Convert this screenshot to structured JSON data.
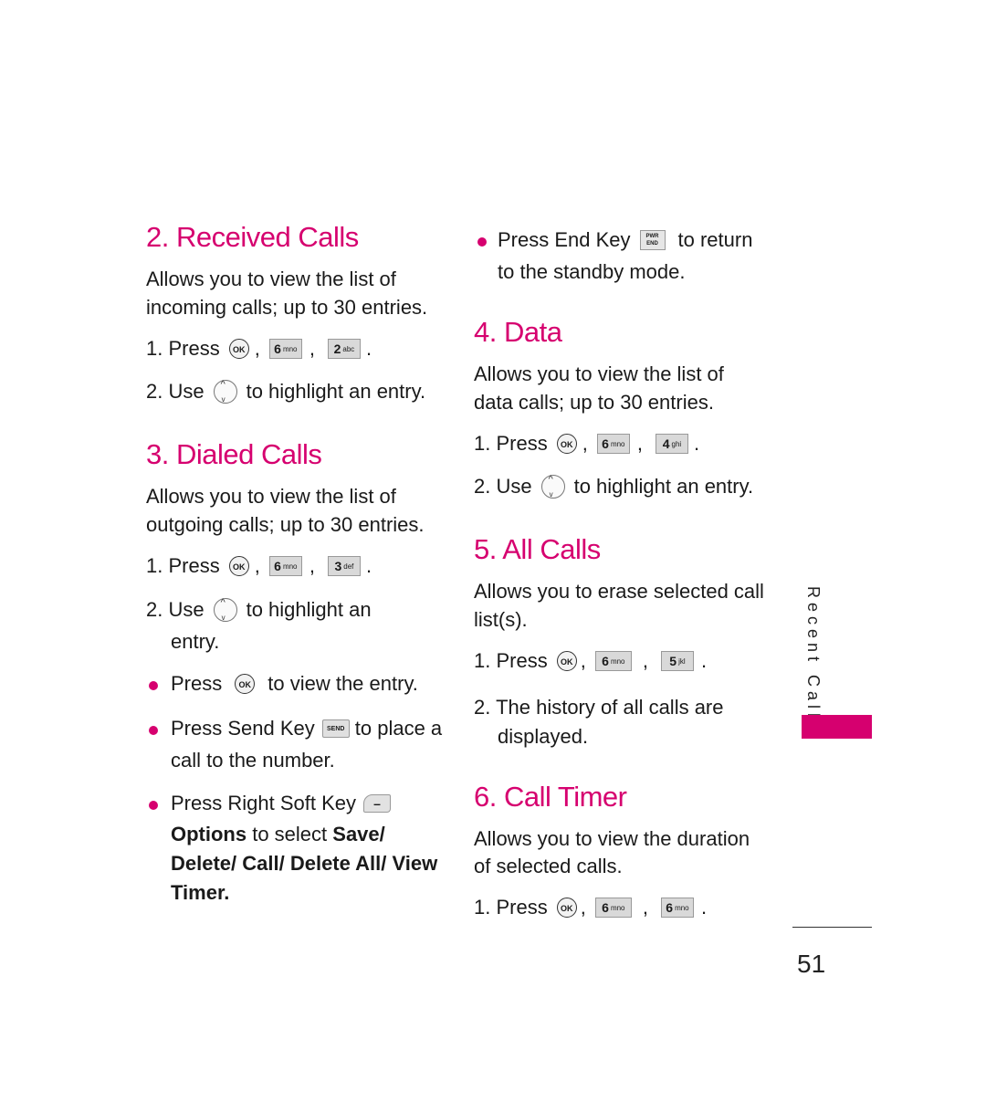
{
  "sections": {
    "received": {
      "title": "2. Received Calls",
      "desc_lines": [
        "Allows you to view the list of",
        "incoming calls; up to 30 entries."
      ],
      "step1_label": "1. Press",
      "step1_keys": [
        "OK",
        "6 mno",
        "2 abc"
      ],
      "step2_label": "2. Use",
      "step2_text": "to highlight an entry."
    },
    "dialed": {
      "title": "3. Dialed Calls",
      "desc_lines": [
        "Allows you to view the list of",
        "outgoing calls; up to 30 entries."
      ],
      "step1_label": "1. Press",
      "step1_keys": [
        "OK",
        "6 mno",
        "3 def"
      ],
      "step2_label": "2.  Use",
      "step2_text": "to highlight an",
      "step2_cont": "entry.",
      "bullets": [
        {
          "before": "Press",
          "key": "OK",
          "after": "to view the entry."
        },
        {
          "before": "Press Send Key",
          "key": "SEND",
          "after": "to place a",
          "cont": "call to the number."
        },
        {
          "before": "Press Right Soft Key",
          "key": "right-soft-key",
          "line2_bold1": "Options",
          "line2_plain": " to select ",
          "line2_bold2": "Save/",
          "line3": "Delete/ Call/ Delete All/ View",
          "line4": "Timer."
        }
      ]
    },
    "end_key_bullet": {
      "before": "Press End Key",
      "key": "PWR END",
      "after": "to return",
      "cont": "to the standby mode."
    },
    "data": {
      "title": "4. Data",
      "desc_lines": [
        "Allows you to view the list of",
        "data calls; up to 30 entries."
      ],
      "step1_label": "1. Press",
      "step1_keys": [
        "OK",
        "6 mno",
        "4 ghi"
      ],
      "step2_label": "2. Use",
      "step2_text": "to highlight an entry."
    },
    "all": {
      "title": "5. All Calls",
      "desc_lines": [
        "Allows you to erase selected call",
        "list(s)."
      ],
      "step1_label": "1. Press",
      "step1_keys": [
        "OK",
        "6 mno",
        "5 jkl"
      ],
      "step2_label": "2. The history of all calls are",
      "step2_cont": "displayed."
    },
    "timer": {
      "title": "6. Call Timer",
      "desc_lines": [
        "Allows you to view the duration",
        "of selected calls."
      ],
      "step1_label": "1. Press",
      "step1_keys": [
        "OK",
        "6 mno",
        "6 mno"
      ]
    }
  },
  "keys": {
    "ok": "OK",
    "send": "SEND",
    "end_top": "PWR",
    "end_bottom": "END",
    "soft": "–",
    "k6": "6",
    "k6s": "mno",
    "k2": "2",
    "k2s": "abc",
    "k3": "3",
    "k3s": "def",
    "k4": "4",
    "k4s": "ghi",
    "k5": "5",
    "k5s": "jkl",
    "comma": ",",
    "period": "."
  },
  "sidebar": {
    "section_label": "Recent Calls",
    "accent_color": "#d6006f"
  },
  "page_number": "51"
}
